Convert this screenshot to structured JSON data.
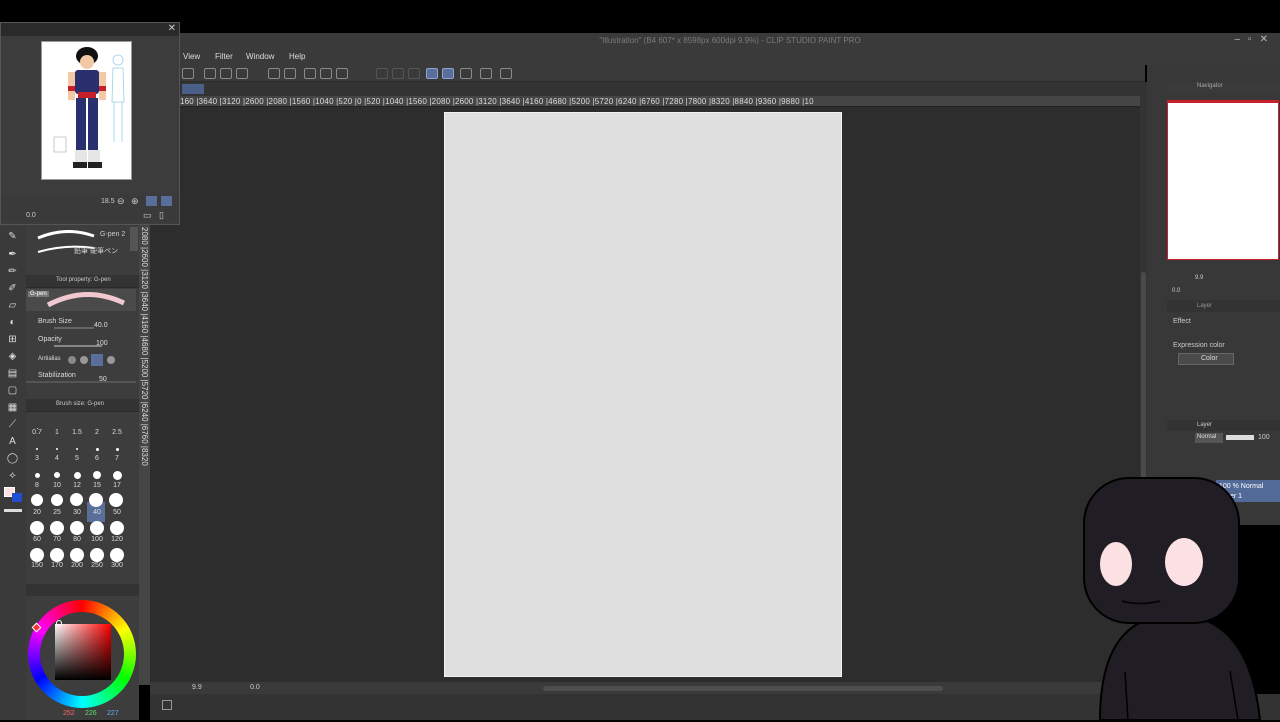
{
  "window": {
    "title": "\"Illustration\" (B4 607* x 8598px 600dpi 9.9%)  - CLIP STUDIO PAINT PRO"
  },
  "menu": [
    {
      "label": "View"
    },
    {
      "label": "Filter"
    },
    {
      "label": "Window"
    },
    {
      "label": "Help"
    }
  ],
  "ruler_h": "160 |3640 |3120 |2600 |2080 |1560 |1040 |520 |0 |520 |1040 |1560 |2080 |2600 |3120 |3640 |4160 |4680 |5200 |5720 |6240 |6760 |7280 |7800 |8320 |8840 |9360 |9880 |10",
  "ruler_v": "2080 |2600 |3120 |3640 |4160 |4680 |5200 |5720 |6240 |6760 |8320",
  "subview": {
    "zoom": "18.5",
    "rotate": "0.0"
  },
  "tools": {
    "brush_names": [
      "G-pen 2",
      "鉛筆 硬筆ペン"
    ],
    "tool_property_title": "Tool property: G-pen",
    "tool_name": "G-pen",
    "brush_size_label": "Brush Size",
    "brush_size_value": "40.0",
    "opacity_label": "Opacity",
    "opacity_value": "100",
    "antialias_label": "Antialias",
    "stabilization_label": "Stabilization",
    "stabilization_value": "50",
    "brush_size_panel_title": "Brush size: G-pen",
    "brush_sizes": [
      "0.7",
      "1",
      "1.5",
      "2",
      "2.5",
      "3",
      "4",
      "5",
      "6",
      "7",
      "8",
      "10",
      "12",
      "15",
      "17",
      "20",
      "25",
      "30",
      "40",
      "50",
      "60",
      "70",
      "80",
      "100",
      "120",
      "150",
      "170",
      "200",
      "250",
      "300"
    ],
    "selected_size": "40"
  },
  "color": {
    "r": "252",
    "g": "226",
    "b": "227",
    "main": "#fce2e3",
    "accent": "#5a6e9a"
  },
  "canvas": {
    "zoom": "9.9",
    "rotate": "0.0",
    "paper_color": "#e0dfe0"
  },
  "navigator": {
    "title": "Navigator",
    "zoom": "9.9",
    "rotate": "0.0"
  },
  "layer_property": {
    "title": "Layer",
    "effect": "Effect",
    "expression_color_label": "Expression color",
    "expression_color_value": "Color"
  },
  "layer": {
    "title": "Layer",
    "blend": "Normal",
    "opacity": "100",
    "row_info": "100 % Normal",
    "row_name": "er 1"
  },
  "icons": [
    "pencil-icon",
    "pen-icon",
    "eraser-icon",
    "fill-icon",
    "gradient-icon",
    "text-icon",
    "lasso-icon",
    "eyedropper-icon",
    "close-icon"
  ]
}
